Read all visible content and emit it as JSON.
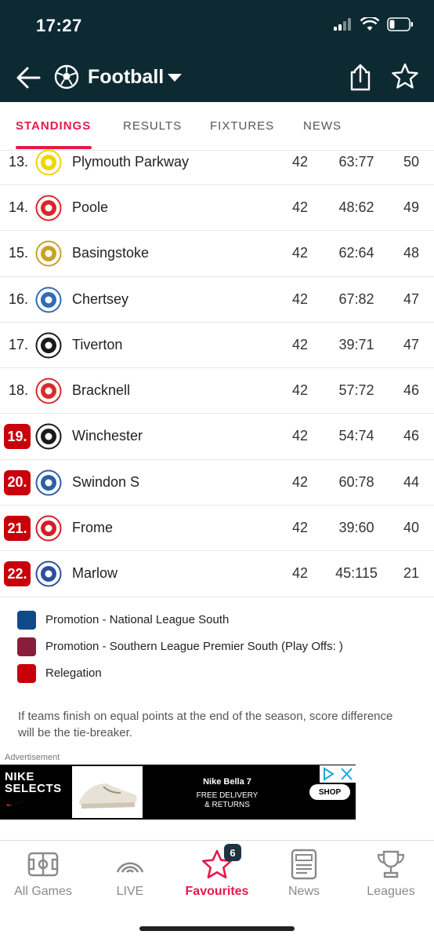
{
  "status_bar": {
    "time": "17:27"
  },
  "header": {
    "title": "Football"
  },
  "tabs": [
    {
      "label": "STANDINGS",
      "active": true
    },
    {
      "label": "RESULTS",
      "active": false
    },
    {
      "label": "FIXTURES",
      "active": false
    },
    {
      "label": "NEWS",
      "active": false
    }
  ],
  "standings": [
    {
      "rank": "13.",
      "team": "Plymouth Parkway",
      "played": "42",
      "score": "63:77",
      "points": "50",
      "zone": "none",
      "crest_color": "#f2d400"
    },
    {
      "rank": "14.",
      "team": "Poole",
      "played": "42",
      "score": "48:62",
      "points": "49",
      "zone": "none",
      "crest_color": "#d9262b"
    },
    {
      "rank": "15.",
      "team": "Basingstoke",
      "played": "42",
      "score": "62:64",
      "points": "48",
      "zone": "none",
      "crest_color": "#c9a227"
    },
    {
      "rank": "16.",
      "team": "Chertsey",
      "played": "42",
      "score": "67:82",
      "points": "47",
      "zone": "none",
      "crest_color": "#2f6db3"
    },
    {
      "rank": "17.",
      "team": "Tiverton",
      "played": "42",
      "score": "39:71",
      "points": "47",
      "zone": "none",
      "crest_color": "#1a1a1a"
    },
    {
      "rank": "18.",
      "team": "Bracknell",
      "played": "42",
      "score": "57:72",
      "points": "46",
      "zone": "none",
      "crest_color": "#d92b2b"
    },
    {
      "rank": "19.",
      "team": "Winchester",
      "played": "42",
      "score": "54:74",
      "points": "46",
      "zone": "relegation",
      "crest_color": "#1a1a1a"
    },
    {
      "rank": "20.",
      "team": "Swindon S",
      "played": "42",
      "score": "60:78",
      "points": "44",
      "zone": "relegation",
      "crest_color": "#2b5fa8"
    },
    {
      "rank": "21.",
      "team": "Frome",
      "played": "42",
      "score": "39:60",
      "points": "40",
      "zone": "relegation",
      "crest_color": "#d21f2a"
    },
    {
      "rank": "22.",
      "team": "Marlow",
      "played": "42",
      "score": "45:115",
      "points": "21",
      "zone": "relegation",
      "crest_color": "#2a4fa0"
    }
  ],
  "legend": [
    {
      "label": "Promotion - National League South",
      "color": "#0e4a8a"
    },
    {
      "label": "Promotion - Southern League Premier South (Play Offs: )",
      "color": "#8a1c3c"
    },
    {
      "label": "Relegation",
      "color": "#c8000a"
    }
  ],
  "tiebreak_note": "If teams finish on equal points at the end of the season, score difference will be the tie-breaker.",
  "ad": {
    "label": "Advertisement",
    "brand_line1": "NIKE",
    "brand_line2": "SELECTS",
    "product": "Nike Bella 7",
    "sub_line1": "FREE DELIVERY",
    "sub_line2": "& RETURNS",
    "cta": "SHOP"
  },
  "bottom_nav": [
    {
      "label": "All Games",
      "icon": "pitch-icon",
      "active": false
    },
    {
      "label": "LIVE",
      "icon": "live-icon",
      "active": false
    },
    {
      "label": "Favourites",
      "icon": "star-icon",
      "active": true,
      "badge": "6"
    },
    {
      "label": "News",
      "icon": "news-icon",
      "active": false
    },
    {
      "label": "Leagues",
      "icon": "trophy-icon",
      "active": false
    }
  ],
  "colors": {
    "accent": "#e5194b",
    "header_bg": "#0d2a33",
    "relegation": "#c8000a"
  }
}
